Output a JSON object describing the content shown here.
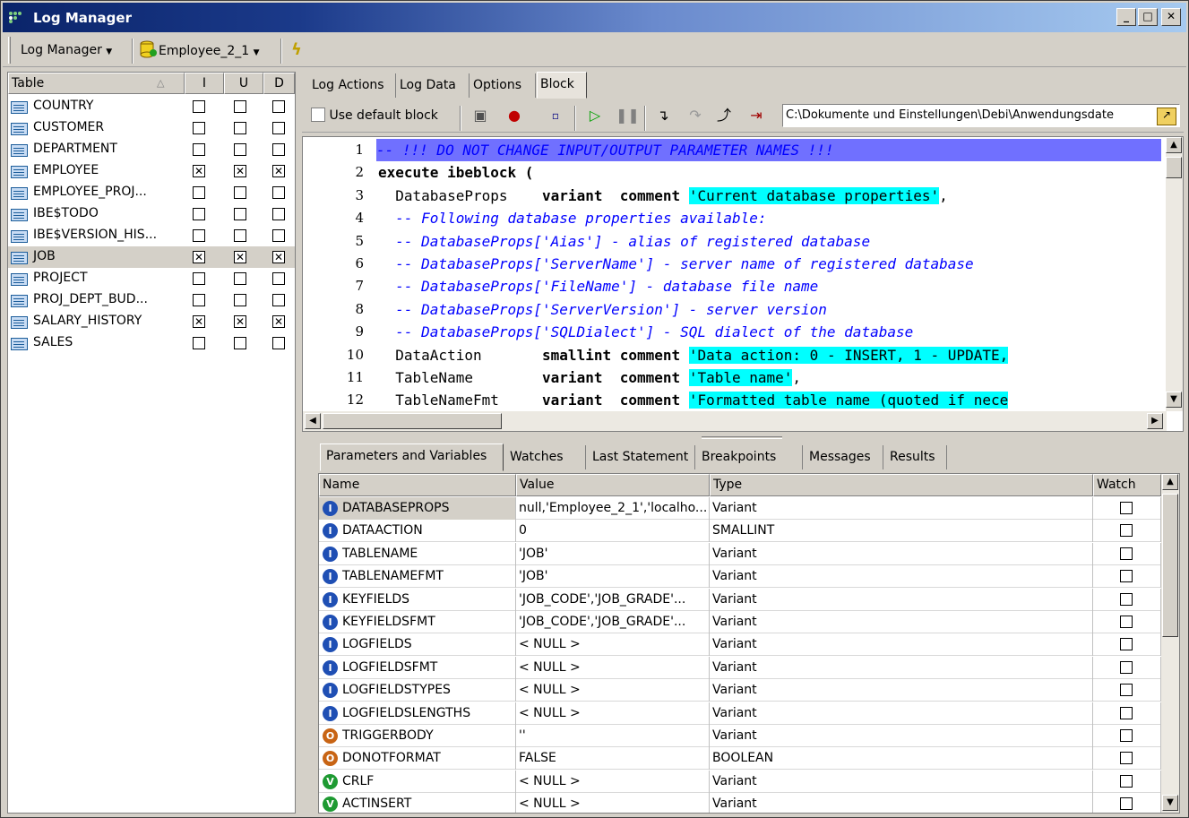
{
  "window": {
    "title": "Log Manager"
  },
  "toolbar": {
    "log_manager_label": "Log Manager",
    "database_label": "Employee_2_1"
  },
  "table_list": {
    "headers": {
      "table": "Table",
      "i": "I",
      "u": "U",
      "d": "D"
    },
    "rows": [
      {
        "name": "COUNTRY",
        "i": false,
        "u": false,
        "d": false
      },
      {
        "name": "CUSTOMER",
        "i": false,
        "u": false,
        "d": false
      },
      {
        "name": "DEPARTMENT",
        "i": false,
        "u": false,
        "d": false
      },
      {
        "name": "EMPLOYEE",
        "i": true,
        "u": true,
        "d": true
      },
      {
        "name": "EMPLOYEE_PROJ...",
        "i": false,
        "u": false,
        "d": false
      },
      {
        "name": "IBE$TODO",
        "i": false,
        "u": false,
        "d": false
      },
      {
        "name": "IBE$VERSION_HIS...",
        "i": false,
        "u": false,
        "d": false
      },
      {
        "name": "JOB",
        "i": true,
        "u": true,
        "d": true,
        "selected": true
      },
      {
        "name": "PROJECT",
        "i": false,
        "u": false,
        "d": false
      },
      {
        "name": "PROJ_DEPT_BUD...",
        "i": false,
        "u": false,
        "d": false
      },
      {
        "name": "SALARY_HISTORY",
        "i": true,
        "u": true,
        "d": true
      },
      {
        "name": "SALES",
        "i": false,
        "u": false,
        "d": false
      }
    ]
  },
  "tabs": [
    "Log Actions",
    "Log Data",
    "Options",
    "Block"
  ],
  "active_tab": "Block",
  "block_toolbar": {
    "use_default_block_label": "Use default block",
    "use_default_block_checked": false,
    "path": "C:\\Dokumente und Einstellungen\\Debi\\Anwendungsdate"
  },
  "editor": {
    "lines": [
      {
        "n": "1",
        "parts": [
          {
            "t": "-- !!! DO NOT CHANGE INPUT/OUTPUT PARAMETER NAMES !!!",
            "c": "line1"
          }
        ]
      },
      {
        "n": "2",
        "parts": [
          {
            "t": "execute ibeblock (",
            "c": "kw"
          }
        ]
      },
      {
        "n": "3",
        "parts": [
          {
            "t": "  DatabaseProps    ",
            "c": ""
          },
          {
            "t": "variant",
            "c": "kw"
          },
          {
            "t": "  ",
            "c": ""
          },
          {
            "t": "comment",
            "c": "kw"
          },
          {
            "t": " ",
            "c": ""
          },
          {
            "t": "'Current database properties'",
            "c": "str"
          },
          {
            "t": ",",
            "c": ""
          }
        ]
      },
      {
        "n": "4",
        "parts": [
          {
            "t": "  -- Following database properties available:",
            "c": "cm"
          }
        ]
      },
      {
        "n": "5",
        "parts": [
          {
            "t": "  -- DatabaseProps['Aias'] - alias of registered database",
            "c": "cm"
          }
        ]
      },
      {
        "n": "6",
        "parts": [
          {
            "t": "  -- DatabaseProps['ServerName'] - server name of registered database",
            "c": "cm"
          }
        ]
      },
      {
        "n": "7",
        "parts": [
          {
            "t": "  -- DatabaseProps['FileName'] - database file name",
            "c": "cm"
          }
        ]
      },
      {
        "n": "8",
        "parts": [
          {
            "t": "  -- DatabaseProps['ServerVersion'] - server version",
            "c": "cm"
          }
        ]
      },
      {
        "n": "9",
        "parts": [
          {
            "t": "  -- DatabaseProps['SQLDialect'] - SQL dialect of the database",
            "c": "cm"
          }
        ]
      },
      {
        "n": "10",
        "parts": [
          {
            "t": "  DataAction       ",
            "c": ""
          },
          {
            "t": "smallint",
            "c": "kw"
          },
          {
            "t": " ",
            "c": ""
          },
          {
            "t": "comment",
            "c": "kw"
          },
          {
            "t": " ",
            "c": ""
          },
          {
            "t": "'Data action: 0 - INSERT, 1 - UPDATE,",
            "c": "str"
          }
        ]
      },
      {
        "n": "11",
        "parts": [
          {
            "t": "  TableName        ",
            "c": ""
          },
          {
            "t": "variant",
            "c": "kw"
          },
          {
            "t": "  ",
            "c": ""
          },
          {
            "t": "comment",
            "c": "kw"
          },
          {
            "t": " ",
            "c": ""
          },
          {
            "t": "'Table name'",
            "c": "str"
          },
          {
            "t": ",",
            "c": ""
          }
        ]
      },
      {
        "n": "12",
        "parts": [
          {
            "t": "  TableNameFmt     ",
            "c": ""
          },
          {
            "t": "variant",
            "c": "kw"
          },
          {
            "t": "  ",
            "c": ""
          },
          {
            "t": "comment",
            "c": "kw"
          },
          {
            "t": " ",
            "c": ""
          },
          {
            "t": "'Formatted table name (quoted if nece",
            "c": "str"
          }
        ]
      }
    ]
  },
  "bottom_tabs": [
    "Parameters and Variables",
    "Watches",
    "Last Statement",
    "Breakpoints",
    "Messages",
    "Results"
  ],
  "active_bottom_tab": "Parameters and Variables",
  "params": {
    "headers": {
      "name": "Name",
      "value": "Value",
      "type": "Type",
      "watch": "Watch"
    },
    "rows": [
      {
        "kind": "I",
        "name": "DATABASEPROPS",
        "value": "null,'Employee_2_1','localho...",
        "type": "Variant",
        "selected": true
      },
      {
        "kind": "I",
        "name": "DATAACTION",
        "value": "0",
        "type": "SMALLINT"
      },
      {
        "kind": "I",
        "name": "TABLENAME",
        "value": "'JOB'",
        "type": "Variant"
      },
      {
        "kind": "I",
        "name": "TABLENAMEFMT",
        "value": "'JOB'",
        "type": "Variant"
      },
      {
        "kind": "I",
        "name": "KEYFIELDS",
        "value": "'JOB_CODE','JOB_GRADE'...",
        "type": "Variant"
      },
      {
        "kind": "I",
        "name": "KEYFIELDSFMT",
        "value": "'JOB_CODE','JOB_GRADE'...",
        "type": "Variant"
      },
      {
        "kind": "I",
        "name": "LOGFIELDS",
        "value": "< NULL >",
        "type": "Variant"
      },
      {
        "kind": "I",
        "name": "LOGFIELDSFMT",
        "value": "< NULL >",
        "type": "Variant"
      },
      {
        "kind": "I",
        "name": "LOGFIELDSTYPES",
        "value": "< NULL >",
        "type": "Variant"
      },
      {
        "kind": "I",
        "name": "LOGFIELDSLENGTHS",
        "value": "< NULL >",
        "type": "Variant"
      },
      {
        "kind": "O",
        "name": "TRIGGERBODY",
        "value": "''",
        "type": "Variant"
      },
      {
        "kind": "O",
        "name": "DONOTFORMAT",
        "value": "FALSE",
        "type": "BOOLEAN"
      },
      {
        "kind": "V",
        "name": "CRLF",
        "value": "< NULL >",
        "type": "Variant"
      },
      {
        "kind": "V",
        "name": "ACTINSERT",
        "value": "< NULL >",
        "type": "Variant"
      }
    ]
  },
  "colors": {
    "input_icon": "#1f4fb4",
    "output_icon": "#c86414",
    "var_icon": "#1e9a32",
    "string_bg": "#00ffff",
    "comment": "#0000ff",
    "line1_bg": "#7070ff"
  }
}
